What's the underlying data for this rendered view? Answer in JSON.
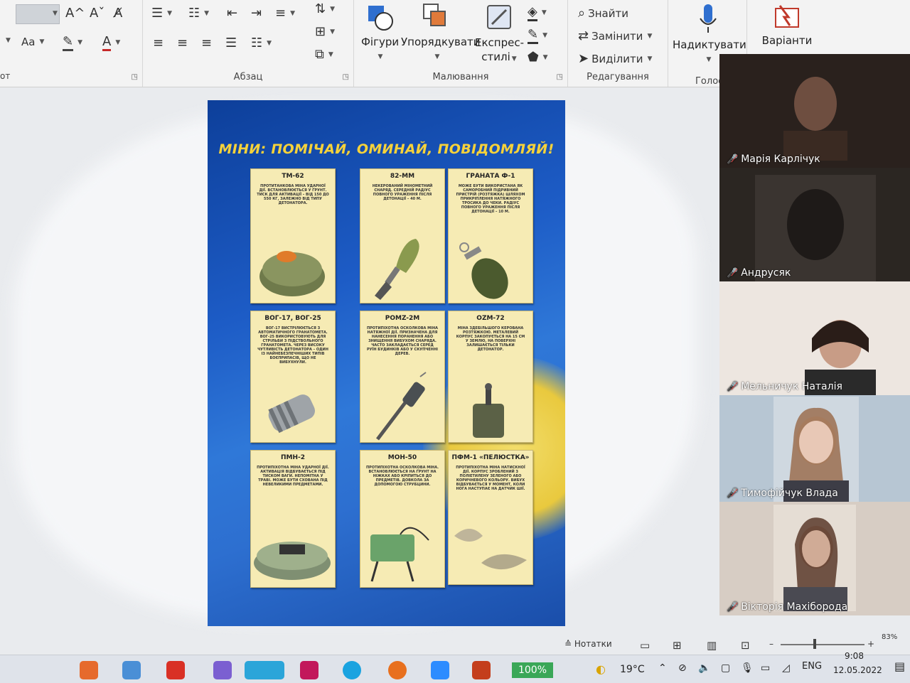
{
  "ribbon": {
    "font_controls": {
      "grow_icon": "A^",
      "shrink_icon": "Aˇ",
      "case_label": "Aa"
    },
    "groups": {
      "paragraph_label": "Абзац",
      "drawing_label": "Малювання",
      "editing_label": "Редагування",
      "voice_label": "Голос"
    },
    "drawing": {
      "shapes": "Фігури",
      "arrange": "Упорядкувати",
      "quick_styles_1": "Експрес-",
      "quick_styles_2": "стилі"
    },
    "editing": {
      "find": "Знайти",
      "replace": "Замінити",
      "select": "Виділити"
    },
    "voice": {
      "dictate": "Надиктувати"
    },
    "designer": {
      "variants": "Варіанти"
    },
    "left_edge_label": "от"
  },
  "poster": {
    "title": "МІНИ: ПОМІЧАЙ, ОМИНАЙ, ПОВІДОМЛЯЙ!",
    "cards": [
      {
        "title": "ТМ-62",
        "desc": "ПРОТИТАНКОВА МІНА УДАРНОЇ ДІЇ. ВСТАНОВЛЮЄТЬСЯ У ҐРУНТ. ТИСК ДЛЯ АКТИВАЦІЇ – ВІД 150 ДО 550 КГ, ЗАЛЕЖНО ВІД ТИПУ ДЕТОНАТОРА."
      },
      {
        "title": "82-ММ",
        "desc": "НЕКЕРОВАНИЙ МІНОМЕТНИЙ СНАРЯД. СЕРЕДНІЙ РАДІУС ПОВНОГО УРАЖЕННЯ ПІСЛЯ ДЕТОНАЦІЇ – 40 М."
      },
      {
        "title": "ГРАНАТА Ф-1",
        "desc": "МОЖЕ БУТИ ВИКОРИСТАНА ЯК САМОРОБНИЙ ПІДРИВНИЙ ПРИСТРІЙ (РОЗТЯЖКА) ШЛЯХОМ ПРИКРІПЛЕННЯ НАТЯЖНОГО ТРОСИКА ДО ЧЕКИ. РАДІУС ПОВНОГО УРАЖЕННЯ ПІСЛЯ ДЕТОНАЦІЇ – 10 М."
      },
      {
        "title": "ВОГ-17, ВОГ-25",
        "desc": "ВОГ-17 ВИСТРІЛЮЄТЬСЯ З АВТОМАТИЧНОГО ГРАНАТОМЕТА. ВОГ-25 ВИКОРИСТОВУЮТЬ ДЛЯ СТРІЛЬБИ З ПІДСТВОЛЬНОГО ГРАНАТОМЕТА. ЧЕРЕЗ ВИСОКУ ЧУТЛИВІСТЬ ДЕТОНАТОРА – ОДИН ІЗ НАЙНЕБЕЗПЕЧНІШИХ ТИПІВ БОЄПРИПАСІВ, ЩО НЕ ВИБУХНУЛИ."
      },
      {
        "title": "POMZ-2M",
        "desc": "ПРОТИПІХОТНА ОСКОЛКОВА МІНА НАТЯЖНОЇ ДІЇ. ПРИЗНАЧЕНА ДЛЯ НАНЕСЕННЯ ПОРАНЕННЯ АБО ЗНИЩЕННЯ ВИБУХОМ СНАРЯДА. ЧАСТО ЗАКЛАДАЄТЬСЯ СЕРЕД РУЇН БУДИНКІВ АБО У СКУПЧЕННІ ДЕРЕВ."
      },
      {
        "title": "OZM-72",
        "desc": "МІНА ЗДЕБІЛЬШОГО КЕРОВАНА РОЗТЯЖКОЮ. МЕТАЛЕВИЙ КОРПУС ЗАКОПУЄТЬСЯ НА 15 СМ У ЗЕМЛЮ, НА ПОВЕРХНІ ЗАЛИШАЄТЬСЯ ТІЛЬКИ ДЕТОНАТОР."
      },
      {
        "title": "ПМН-2",
        "desc": "ПРОТИПІХОТНА МІНА УДАРНОЇ ДІЇ. АКТИВАЦІЯ ВІДБУВАЄТЬСЯ ПІД ТИСКОМ ВАГИ. НЕПОМІТНА У ТРАВІ. МОЖЕ БУТИ СХОВАНА ПІД НЕВЕЛИКИМИ ПРЕДМЕТАМИ."
      },
      {
        "title": "МОН-50",
        "desc": "ПРОТИПІХОТНА ОСКОЛКОВА МІНА. ВСТАНОВЛЮЄТЬСЯ НА ҐРУНТ НА НІЖКАХ АБО КРІПИТЬСЯ ДО ПРЕДМЕТІВ. ДОВКОЛА ЗА ДОПОМОГОЮ СТРУБЦИНИ."
      },
      {
        "title": "ПФМ-1 «ПЕЛЮСТКА»",
        "desc": "ПРОТИПІХОТНА МІНА НАТИСКНОЇ ДІЇ. КОРПУС ЗРОБЛЕНИЙ З ПОЛІЕТИЛЕНУ ЗЕЛЕНОГО АБО КОРИЧНЕВОГО КОЛЬОРУ. ВИБУХ ВІДБУВАЄТЬСЯ У МОМЕНТ, КОЛИ НОГА НАСТУПАЄ НА ДАТЧИК ШІЇ."
      }
    ]
  },
  "participants": [
    {
      "name": "Марія Карлічук"
    },
    {
      "name": "Андрусяк"
    },
    {
      "name": "Мельничук Наталія"
    },
    {
      "name": "Тимофійчук Влада"
    },
    {
      "name": "Вікторія Махіборода"
    }
  ],
  "statusbar": {
    "notes": "Нотатки",
    "zoom_minus": "–",
    "zoom_plus": "+",
    "zoom_percent": "83%"
  },
  "taskbar": {
    "battery_badge": "100%",
    "weather": "19°C",
    "language": "ENG",
    "time": "9:08",
    "date": "12.05.2022"
  },
  "colors": {
    "poster_blue": "#1d5cc6",
    "poster_yellow": "#f6d23a",
    "card_bg": "#f6ebb4",
    "mic_off": "#e03a3a",
    "badge_green": "#3aa757"
  }
}
